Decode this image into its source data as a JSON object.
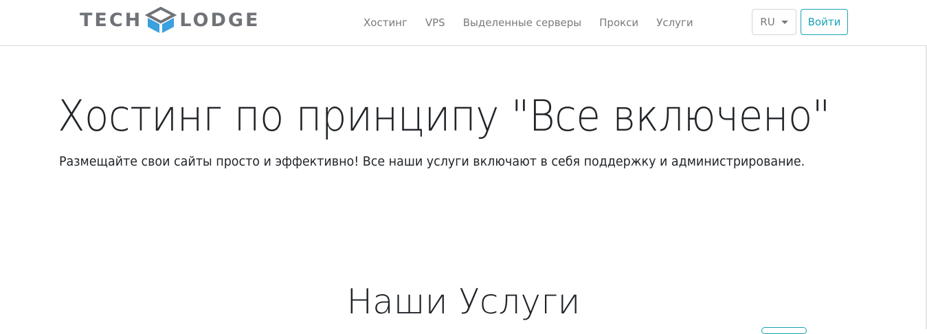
{
  "brand": {
    "logo_left": "TECH",
    "logo_right": "LODGE",
    "colors": {
      "text": "#6f7378",
      "cube_blue": "#3aa0e0",
      "cube_gray": "#6f7378"
    }
  },
  "nav": {
    "links": [
      {
        "label": "Хостинг"
      },
      {
        "label": "VPS"
      },
      {
        "label": "Выделенные серверы"
      },
      {
        "label": "Прокси"
      },
      {
        "label": "Услуги"
      }
    ],
    "language": "RU",
    "login_label": "Войти"
  },
  "hero": {
    "title": "Хостинг по принципу \"Все включено\"",
    "subtitle": "Размещайте свои сайты просто и эффективно! Все наши услуги включают в себя поддержку и администрирование."
  },
  "services": {
    "title": "Наши Услуги"
  },
  "colors": {
    "accent": "#17a2b8",
    "border": "#dcdcdc",
    "nav_text": "#7a7a7a"
  }
}
